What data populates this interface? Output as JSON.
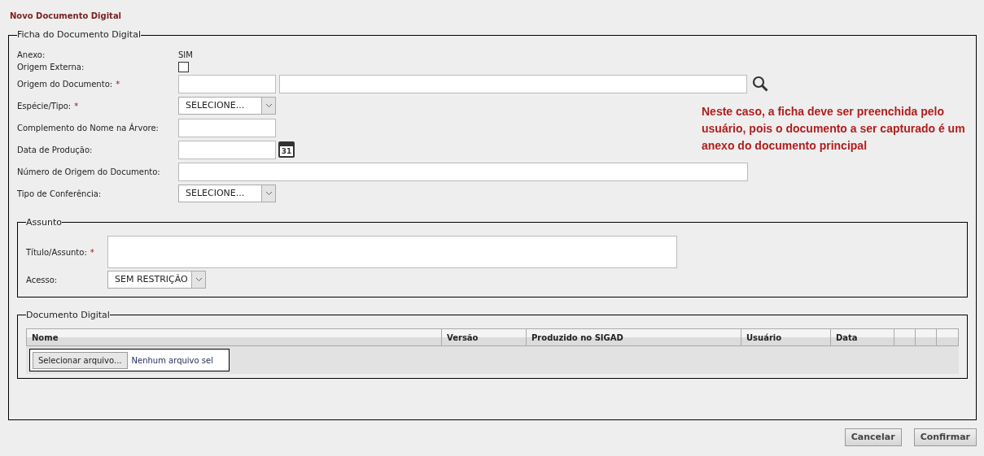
{
  "title": "Novo Documento Digital",
  "required_mark": "*",
  "ficha": {
    "legend": "Ficha do Documento Digital",
    "anexo": {
      "label": "Anexo:",
      "value": "SIM"
    },
    "origem_externa": {
      "label": "Origem Externa:",
      "checked": false
    },
    "fields": [
      {
        "kind": "double",
        "label": "Origem do Documento:",
        "required": true
      },
      {
        "kind": "select",
        "label": "Espécie/Tipo:",
        "required": true,
        "value": "SELECIONE..."
      },
      {
        "kind": "text",
        "label": "Complemento do Nome na Árvore:",
        "required": false
      },
      {
        "kind": "date",
        "label": "Data de Produção:",
        "required": false,
        "icon_text": "31"
      },
      {
        "kind": "wide",
        "label": "Número de Origem do Documento:",
        "required": false
      },
      {
        "kind": "select",
        "label": "Tipo de Conferência:",
        "required": false,
        "value": "SELECIONE..."
      }
    ]
  },
  "note": "Neste caso, a ficha deve ser preenchida pelo usuário, pois o documento a ser capturado é um anexo do documento principal",
  "assunto": {
    "legend": "Assunto",
    "titulo": {
      "label": "Título/Assunto:",
      "required": true
    },
    "acesso": {
      "label": "Acesso:",
      "value": "SEM RESTRIÇÃO"
    }
  },
  "documento": {
    "legend": "Documento Digital",
    "columns": [
      "Nome",
      "Versão",
      "Produzido no SIGAD",
      "Usuário",
      "Data"
    ],
    "file_button": "Selecionar arquivo...",
    "file_status": "Nenhum arquivo sel"
  },
  "buttons": [
    "Cancelar",
    "Confirmar"
  ]
}
